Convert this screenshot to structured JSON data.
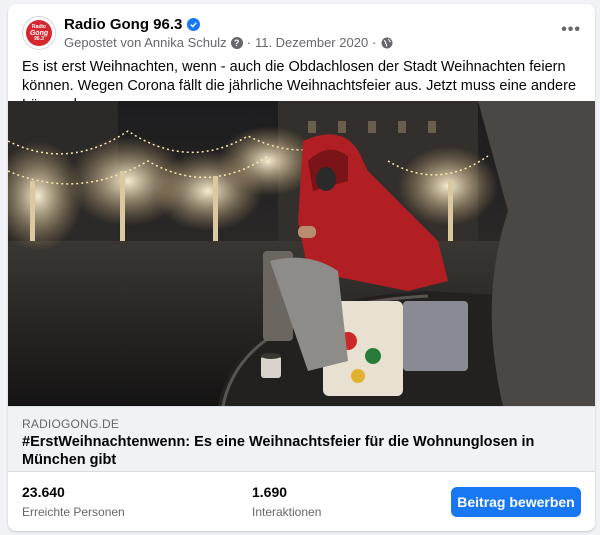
{
  "post": {
    "page_name": "Radio Gong 96.3",
    "avatar_text_top": "Radio",
    "avatar_text_main": "Gong",
    "avatar_text_bottom": "96.3",
    "posted_by": "Gepostet von Annika Schulz",
    "date": "11. Dezember 2020",
    "separator": "·",
    "help_icon_glyph": "?",
    "more_glyph": "•••",
    "text": "Es ist erst Weihnachten, wenn - auch die Obdachlosen der Stadt Weihnachten feiern können. Wegen Corona fällt die jährliche Weihnachtsfeier aus. Jetzt muss eine andere Lösung her:"
  },
  "link": {
    "domain": "RADIOGONG.DE",
    "title": "#ErstWeihnachtenwenn: Es eine Weihnachtsfeier für die Wohnunglosen in München gibt"
  },
  "stats": {
    "reach_value": "23.640",
    "reach_label": "Erreichte Personen",
    "interactions_value": "1.690",
    "interactions_label": "Interaktionen"
  },
  "actions": {
    "promote_label": "Beitrag bewerben"
  },
  "colors": {
    "accent": "#1877f2",
    "brand_red": "#d6262e",
    "text_primary": "#050505",
    "text_secondary": "#65676b",
    "background": "#f0f2f5"
  },
  "icons": [
    "verified-badge-icon",
    "help-icon",
    "globe-icon",
    "more-options-icon"
  ]
}
